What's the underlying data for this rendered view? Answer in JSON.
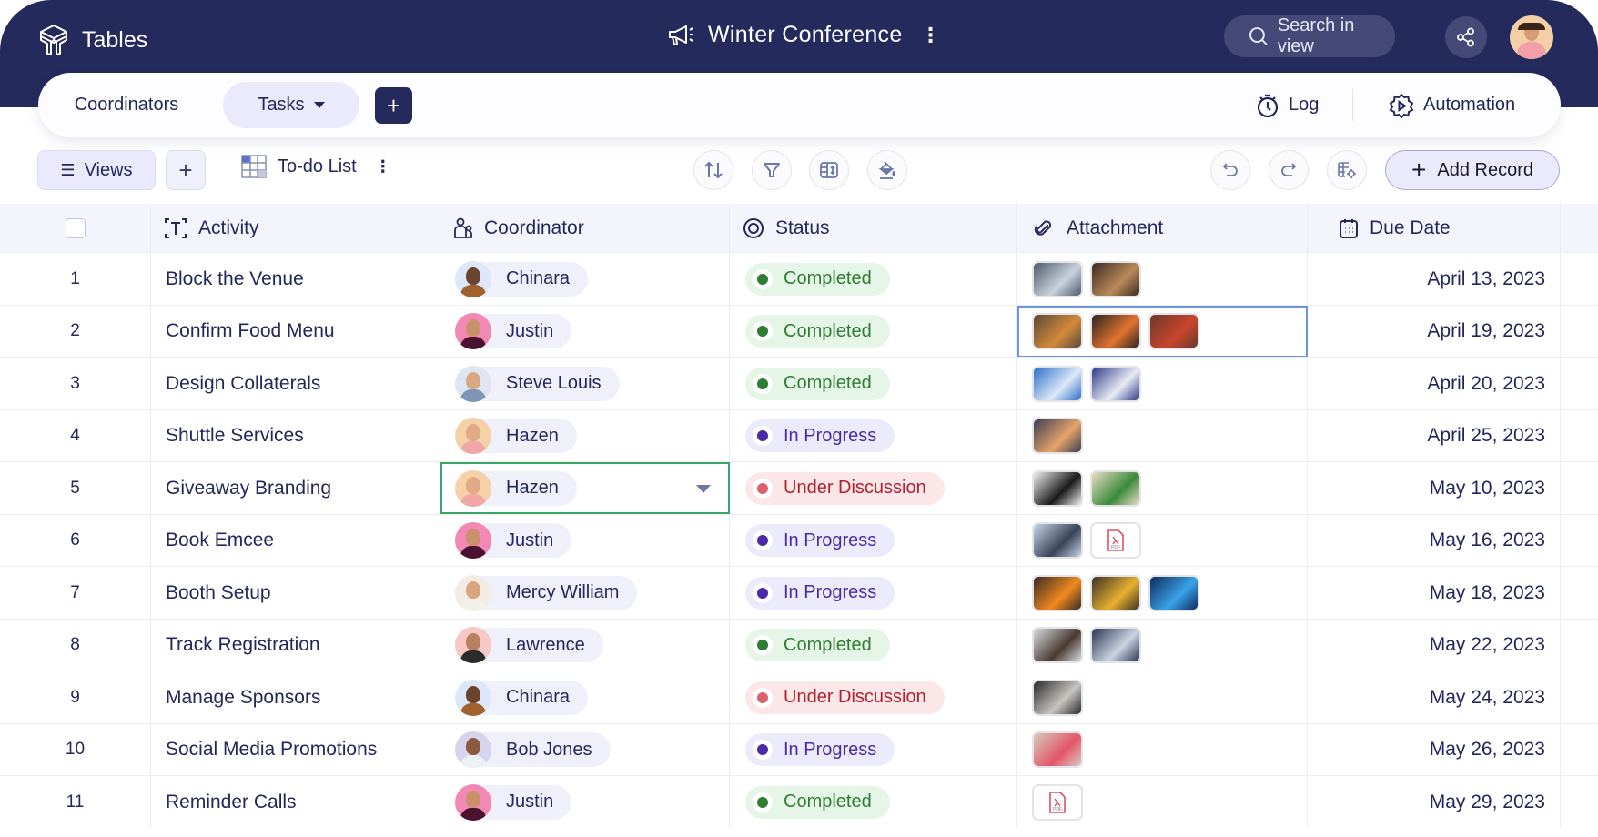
{
  "app": {
    "title": "Tables",
    "logo_icon": "cube-logo-icon"
  },
  "project": {
    "name": "Winter Conference",
    "icon": "megaphone-icon",
    "more_icon": "more-vertical-icon"
  },
  "search": {
    "placeholder": "Search in view",
    "icon": "search-icon"
  },
  "header_actions": {
    "share_icon": "share-icon",
    "avatar": "user-avatar"
  },
  "tabs": [
    {
      "label": "Coordinators",
      "active": false
    },
    {
      "label": "Tasks",
      "active": true,
      "has_dropdown": true
    }
  ],
  "add_tab_label": "+",
  "tab_actions": [
    {
      "label": "Log",
      "icon": "stopwatch-icon"
    },
    {
      "label": "Automation",
      "icon": "automation-gear-icon"
    }
  ],
  "toolbar": {
    "views_label": "Views",
    "add_view_label": "+",
    "view_name": "To-do List",
    "view_icon": "grid-view-icon",
    "tools": [
      "sort-icon",
      "filter-icon",
      "row-height-icon",
      "color-fill-icon"
    ],
    "history": [
      "undo-icon",
      "redo-icon",
      "table-settings-icon"
    ],
    "add_record_label": "Add Record"
  },
  "columns": [
    {
      "label": "Activity",
      "icon": "text-field-icon"
    },
    {
      "label": "Coordinator",
      "icon": "users-icon"
    },
    {
      "label": "Status",
      "icon": "status-icon"
    },
    {
      "label": "Attachment",
      "icon": "paperclip-icon"
    },
    {
      "label": "Due Date",
      "icon": "calendar-icon"
    }
  ],
  "status_styles": {
    "Completed": {
      "bg": "#e5f5e7",
      "dot": "#2e7d32",
      "text": "#2e7d32"
    },
    "In Progress": {
      "bg": "#ecebfb",
      "dot": "#4b2aa8",
      "text": "#4b2aa8"
    },
    "Under Discussion": {
      "bg": "#fbe6e8",
      "dot": "#d9626e",
      "text": "#b3202f"
    }
  },
  "people": {
    "Chinara": {
      "bg": "#dce8f8",
      "skin": "#6b4430",
      "shirt": "#a0612f"
    },
    "Justin": {
      "bg": "#f189b4",
      "skin": "#c9906b",
      "shirt": "#4a1230"
    },
    "Steve Louis": {
      "bg": "#dfe6f2",
      "skin": "#d9a882",
      "shirt": "#7f95b8"
    },
    "Hazen": {
      "bg": "#f4d2a6",
      "skin": "#e0aa86",
      "shirt": "#f1a6a8"
    },
    "Mercy William": {
      "bg": "#f3ece4",
      "skin": "#d9a57f",
      "shirt": "#f3f0ea"
    },
    "Lawrence": {
      "bg": "#f6c9c6",
      "skin": "#b98060",
      "shirt": "#2b2b2b"
    },
    "Bob Jones": {
      "bg": "#d7d3ef",
      "skin": "#8a5a3e",
      "shirt": "#eef1f4"
    }
  },
  "rows": [
    {
      "num": "1",
      "activity": "Block the Venue",
      "coordinator": "Chinara",
      "status": "Completed",
      "attachments": [
        [
          "#4b5a6b",
          "#c9d2dc"
        ],
        [
          "#3b2a22",
          "#b98a5a"
        ]
      ],
      "due": "April 13, 2023"
    },
    {
      "num": "2",
      "activity": "Confirm Food Menu",
      "coordinator": "Justin",
      "status": "Completed",
      "attachments": [
        [
          "#5a4a3a",
          "#d28a3a"
        ],
        [
          "#2a2522",
          "#e2732e"
        ],
        [
          "#6a3a2a",
          "#c9452e"
        ]
      ],
      "due": "April 19, 2023",
      "attachment_selected": true
    },
    {
      "num": "3",
      "activity": "Design Collaterals",
      "coordinator": "Steve Louis",
      "status": "Completed",
      "attachments": [
        [
          "#2a6fc9",
          "#dbe8f7"
        ],
        [
          "#2d3a8a",
          "#e8ebf4"
        ]
      ],
      "due": "April 20, 2023"
    },
    {
      "num": "4",
      "activity": "Shuttle Services",
      "coordinator": "Hazen",
      "status": "In Progress",
      "attachments": [
        [
          "#3a3f52",
          "#e5a36a"
        ]
      ],
      "due": "April 25, 2023"
    },
    {
      "num": "5",
      "activity": "Giveaway Branding",
      "coordinator": "Hazen",
      "status": "Under Discussion",
      "attachments": [
        [
          "#f0f0f0",
          "#1b1b1b"
        ],
        [
          "#e9dcc8",
          "#3b8a3b"
        ]
      ],
      "due": "May 10, 2023",
      "coordinator_selected": true
    },
    {
      "num": "6",
      "activity": "Book Emcee",
      "coordinator": "Justin",
      "status": "In Progress",
      "attachments": [
        [
          "#c6d6e8",
          "#3a4458"
        ],
        "pdf"
      ],
      "due": "May 16, 2023"
    },
    {
      "num": "7",
      "activity": "Booth Setup",
      "coordinator": "Mercy William",
      "status": "In Progress",
      "attachments": [
        [
          "#3a2a22",
          "#ef8a1e"
        ],
        [
          "#3a3128",
          "#e7b02e"
        ],
        [
          "#0e2a5a",
          "#39a3e8"
        ]
      ],
      "due": "May 18, 2023"
    },
    {
      "num": "8",
      "activity": "Track Registration",
      "coordinator": "Lawrence",
      "status": "Completed",
      "attachments": [
        [
          "#d8dde4",
          "#4a3a30"
        ],
        [
          "#2a3550",
          "#c9d3e2"
        ]
      ],
      "due": "May 22, 2023"
    },
    {
      "num": "9",
      "activity": "Manage Sponsors",
      "coordinator": "Chinara",
      "status": "Under Discussion",
      "attachments": [
        [
          "#2a2a2a",
          "#c8c4c0"
        ]
      ],
      "due": "May 24, 2023"
    },
    {
      "num": "10",
      "activity": "Social Media Promotions",
      "coordinator": "Bob Jones",
      "status": "In Progress",
      "attachments": [
        [
          "#d6cbbd",
          "#e4566a"
        ]
      ],
      "due": "May 26, 2023"
    },
    {
      "num": "11",
      "activity": "Reminder Calls",
      "coordinator": "Justin",
      "status": "Completed",
      "attachments": [
        "pdf"
      ],
      "due": "May 29, 2023"
    }
  ]
}
